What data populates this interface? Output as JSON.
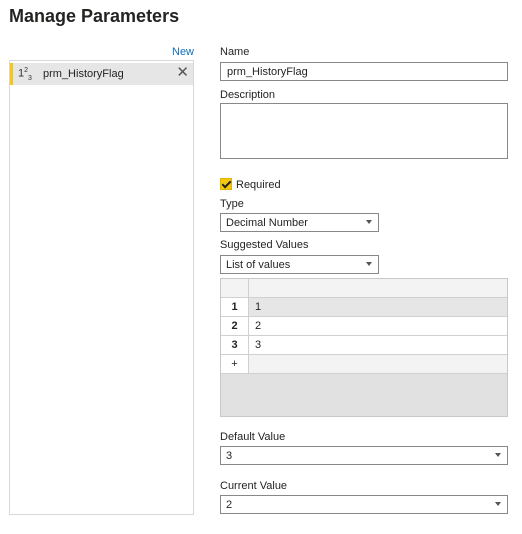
{
  "dialog": {
    "title": "Manage Parameters"
  },
  "left": {
    "new_label": "New",
    "parameters": [
      {
        "type_icon_main": "1",
        "type_icon_sup": "2",
        "type_icon_sub": "3",
        "name": "prm_HistoryFlag",
        "icon": "close-icon"
      }
    ]
  },
  "form": {
    "name_label": "Name",
    "name_value": "prm_HistoryFlag",
    "description_label": "Description",
    "description_value": "",
    "required_label": "Required",
    "required_checked": true,
    "type_label": "Type",
    "type_value": "Decimal Number",
    "suggested_label": "Suggested Values",
    "suggested_value": "List of values",
    "list": {
      "rows": [
        {
          "index": "1",
          "value": "1"
        },
        {
          "index": "2",
          "value": "2"
        },
        {
          "index": "3",
          "value": "3"
        }
      ],
      "add_symbol": "+"
    },
    "default_label": "Default Value",
    "default_value": "3",
    "current_label": "Current Value",
    "current_value": "2"
  },
  "colors": {
    "accent": "#f2c811",
    "link": "#106ebe",
    "selected_bg": "#e6e6e6"
  }
}
